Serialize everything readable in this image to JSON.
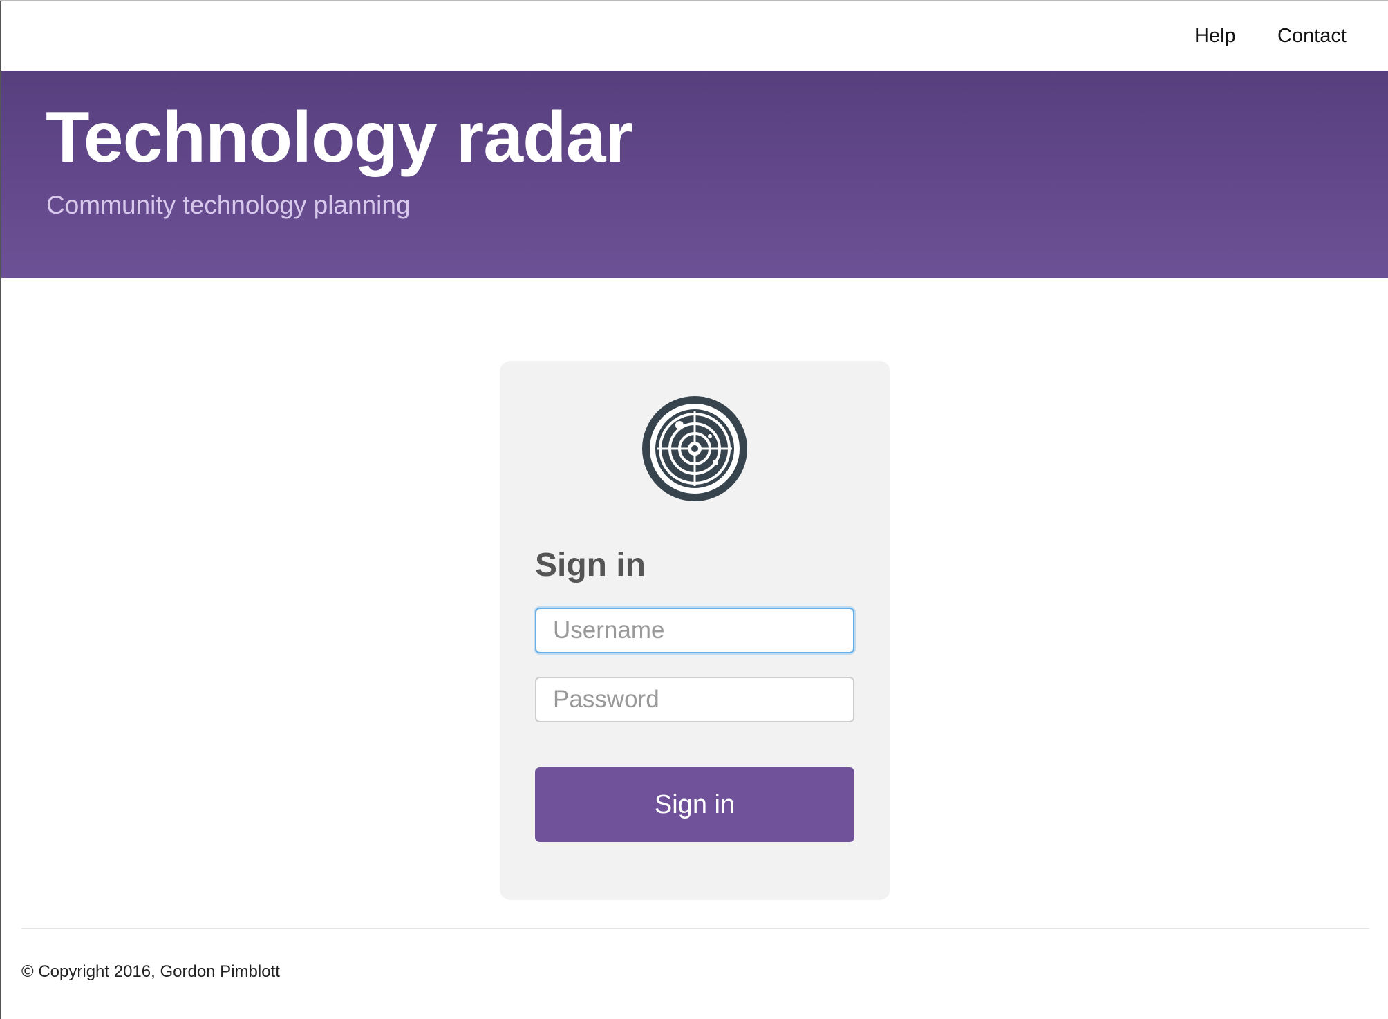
{
  "nav": {
    "links": [
      {
        "label": "Help"
      },
      {
        "label": "Contact"
      }
    ]
  },
  "header": {
    "title": "Technology radar",
    "subtitle": "Community technology planning"
  },
  "signin": {
    "logo_icon": "radar-icon",
    "heading": "Sign in",
    "username": {
      "placeholder": "Username",
      "value": ""
    },
    "password": {
      "placeholder": "Password",
      "value": ""
    },
    "submit_label": "Sign in"
  },
  "footer": {
    "copyright": "© Copyright 2016, Gordon Pimblott"
  },
  "colors": {
    "brand_purple": "#6f529a",
    "banner_top": "#573f7e",
    "banner_bottom": "#6d5196",
    "card_bg": "#f2f2f2",
    "logo_dark": "#37444e"
  }
}
